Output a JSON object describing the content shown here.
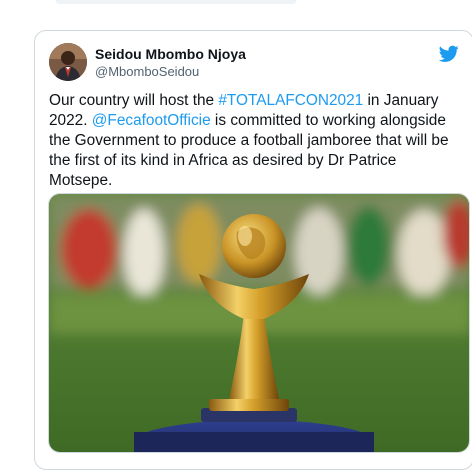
{
  "tweet": {
    "author": {
      "display_name": "Seidou Mbombo Njoya",
      "handle": "@MbomboSeidou"
    },
    "text": {
      "part1": "Our country will host the ",
      "hashtag": "#TOTALAFCON2021",
      "part2": " in January 2022. ",
      "mention": "@FecafootOfficie",
      "part3": " is committed to working alongside the Government to produce a football jamboree that will be the first of its kind in Africa as desired by Dr Patrice Motsepe."
    },
    "media": {
      "subject": "Africa Cup of Nations golden trophy on blue stand, blurred stadium background"
    }
  },
  "icons": {
    "platform": "twitter-bird-icon"
  },
  "colors": {
    "link": "#1d9bf0",
    "text": "#0f1419",
    "secondary": "#536471",
    "border": "#cfd9de",
    "trophy_gold": "#d4a22a"
  }
}
